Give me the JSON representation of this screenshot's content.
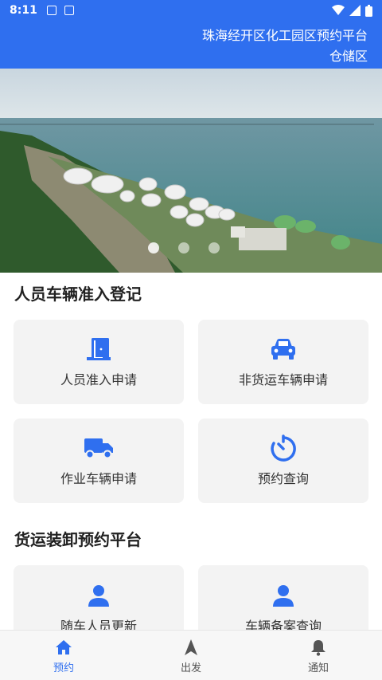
{
  "status_bar": {
    "time": "8:11"
  },
  "header": {
    "title_line1": "珠海经开区化工园区预约平台",
    "title_line2": "仓储区"
  },
  "section1": {
    "title": "人员车辆准入登记",
    "cards": [
      {
        "label": "人员准入申请",
        "icon": "door-icon"
      },
      {
        "label": "非货运车辆申请",
        "icon": "car-icon"
      },
      {
        "label": "作业车辆申请",
        "icon": "truck-icon"
      },
      {
        "label": "预约查询",
        "icon": "timer-icon"
      }
    ]
  },
  "section2": {
    "title": "货运装卸预约平台",
    "cards": [
      {
        "label": "随车人员更新",
        "icon": "person-icon"
      },
      {
        "label": "车辆备案查询",
        "icon": "person-icon"
      }
    ]
  },
  "tabs": [
    {
      "label": "预约",
      "icon": "home-icon",
      "active": true
    },
    {
      "label": "出发",
      "icon": "navigation-arrow-icon",
      "active": false
    },
    {
      "label": "通知",
      "icon": "bell-icon",
      "active": false
    }
  ],
  "colors": {
    "primary": "#2f6fef",
    "card_bg": "#f3f3f3"
  }
}
